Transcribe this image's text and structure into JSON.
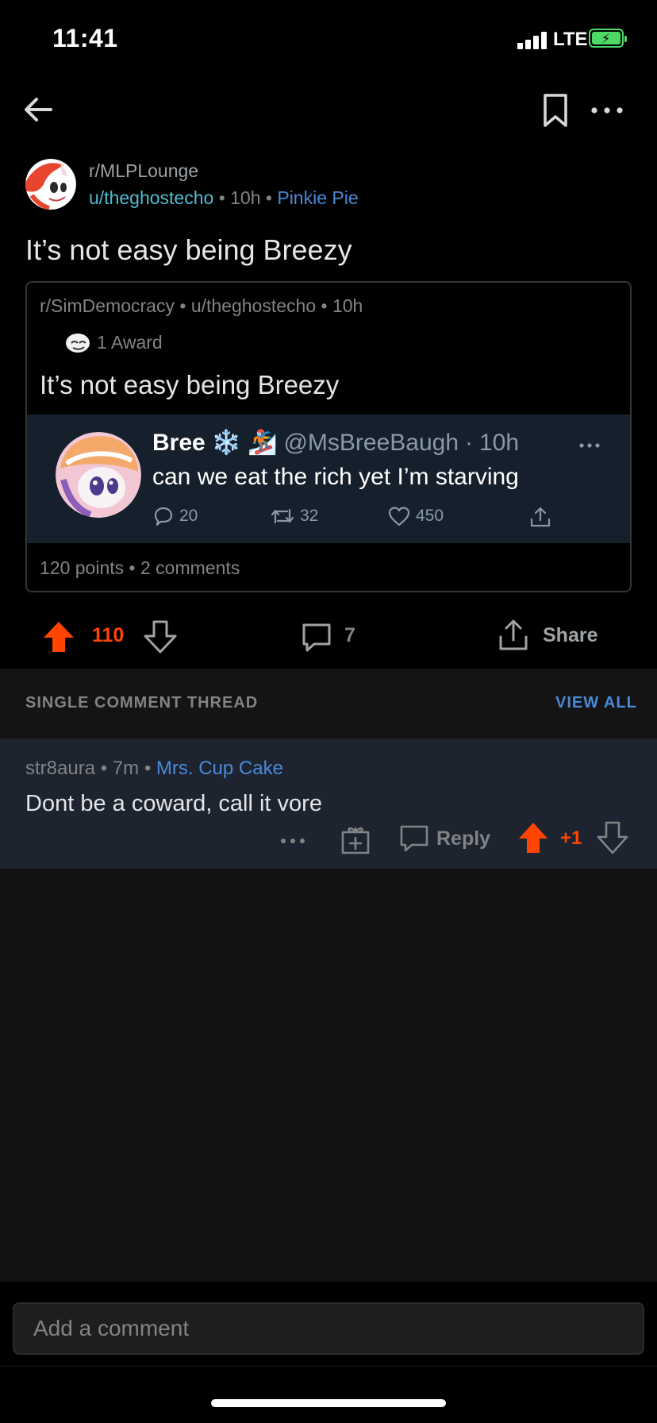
{
  "status_bar": {
    "time": "11:41",
    "network": "LTE"
  },
  "post": {
    "subreddit": "r/MLPLounge",
    "author": "u/theghostecho",
    "age": "10h",
    "flair": "Pinkie Pie",
    "separator": "•",
    "title": "It’s not easy being Breezy"
  },
  "crosspost": {
    "subreddit": "r/SimDemocracy",
    "author": "u/theghostecho",
    "age": "10h",
    "award_text": "1 Award",
    "title": "It’s not easy being Breezy",
    "footer_points": "120 points",
    "footer_comments": "2 comments"
  },
  "tweet": {
    "name": "Bree",
    "emoji_1": "❄️",
    "emoji_2": "🏂",
    "handle": "@MsBreeBaugh",
    "dot": "·",
    "age": "10h",
    "text": "can we eat the rich yet I’m starving",
    "replies": "20",
    "retweets": "32",
    "likes": "450"
  },
  "actions": {
    "vote_count": "110",
    "comment_count": "7",
    "share_label": "Share"
  },
  "thread": {
    "label": "SINGLE COMMENT THREAD",
    "view_all": "VIEW ALL"
  },
  "comment": {
    "author": "str8aura",
    "age": "7m",
    "flair": "Mrs. Cup Cake",
    "text": "Dont be a coward, call it vore",
    "reply_label": "Reply",
    "score": "+1"
  },
  "composer": {
    "placeholder": "Add a comment"
  },
  "colors": {
    "upvote": "#ff4500",
    "link_blue": "#4a8ad8",
    "user_teal": "#4fbcd1",
    "tweet_bg": "#16202d",
    "comment_bg": "#1d2430"
  }
}
